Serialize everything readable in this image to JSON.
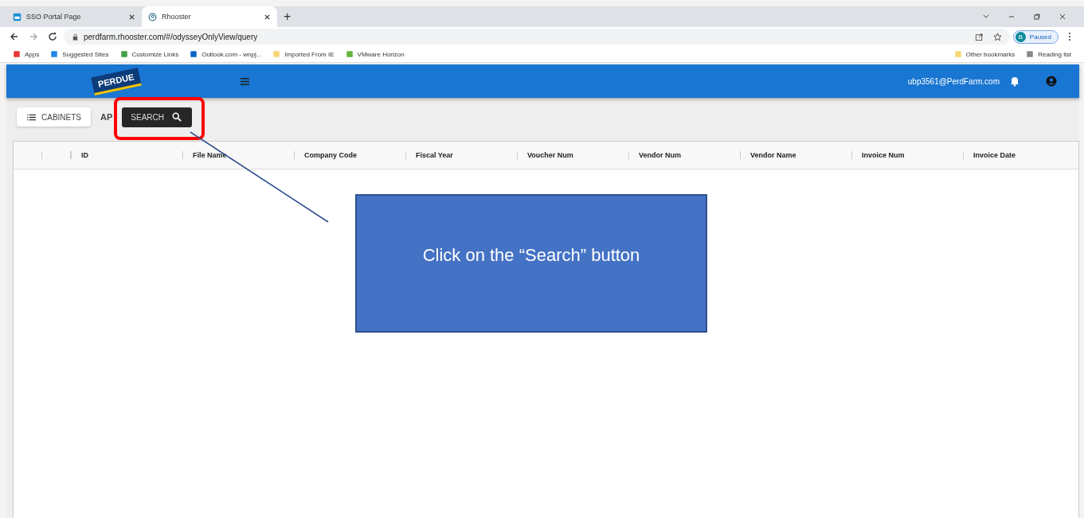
{
  "browser": {
    "tabs": [
      {
        "title": "SSO Portal Page",
        "selected": false
      },
      {
        "title": "Rhooster",
        "selected": true
      }
    ],
    "new_tab": "+",
    "url": "perdfarm.rhooster.com/#/odysseyOnlyView/query",
    "profile": {
      "initial": "B",
      "status": "Paused"
    },
    "bookmarks": [
      "Apps",
      "Suggested Sites",
      "Customize Links",
      "Outlook.com - wnpj...",
      "Imported From IE",
      "VMware Horizon"
    ],
    "bookmarks_right": [
      "Other bookmarks",
      "Reading list"
    ]
  },
  "app": {
    "logo": "PERDUE",
    "user": "ubp3561@PerdFarm.com",
    "toolbar": {
      "cabinets_button": "CABINETS",
      "cabinet_name": "AP",
      "search_button": "SEARCH"
    },
    "table": {
      "columns": [
        "ID",
        "File Name",
        "Company Code",
        "Fiscal Year",
        "Voucher Num",
        "Vendor Num",
        "Vendor Name",
        "Invoice Num",
        "Invoice Date"
      ]
    }
  },
  "callout": {
    "text": "Click on the “Search” button"
  }
}
